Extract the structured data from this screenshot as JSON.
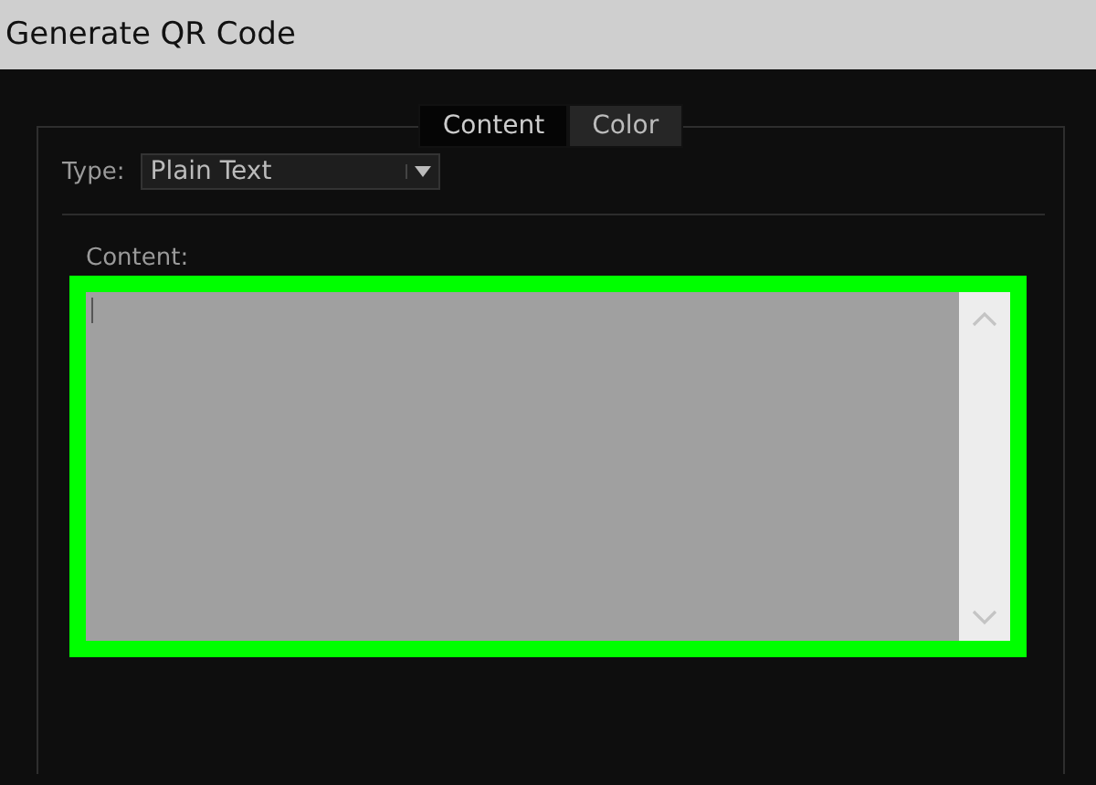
{
  "window": {
    "title": "Generate QR Code"
  },
  "tabs": [
    {
      "label": "Content",
      "selected": true
    },
    {
      "label": "Color",
      "selected": false
    }
  ],
  "type_field": {
    "label": "Type:",
    "value": "Plain Text"
  },
  "content_field": {
    "label": "Content:"
  }
}
